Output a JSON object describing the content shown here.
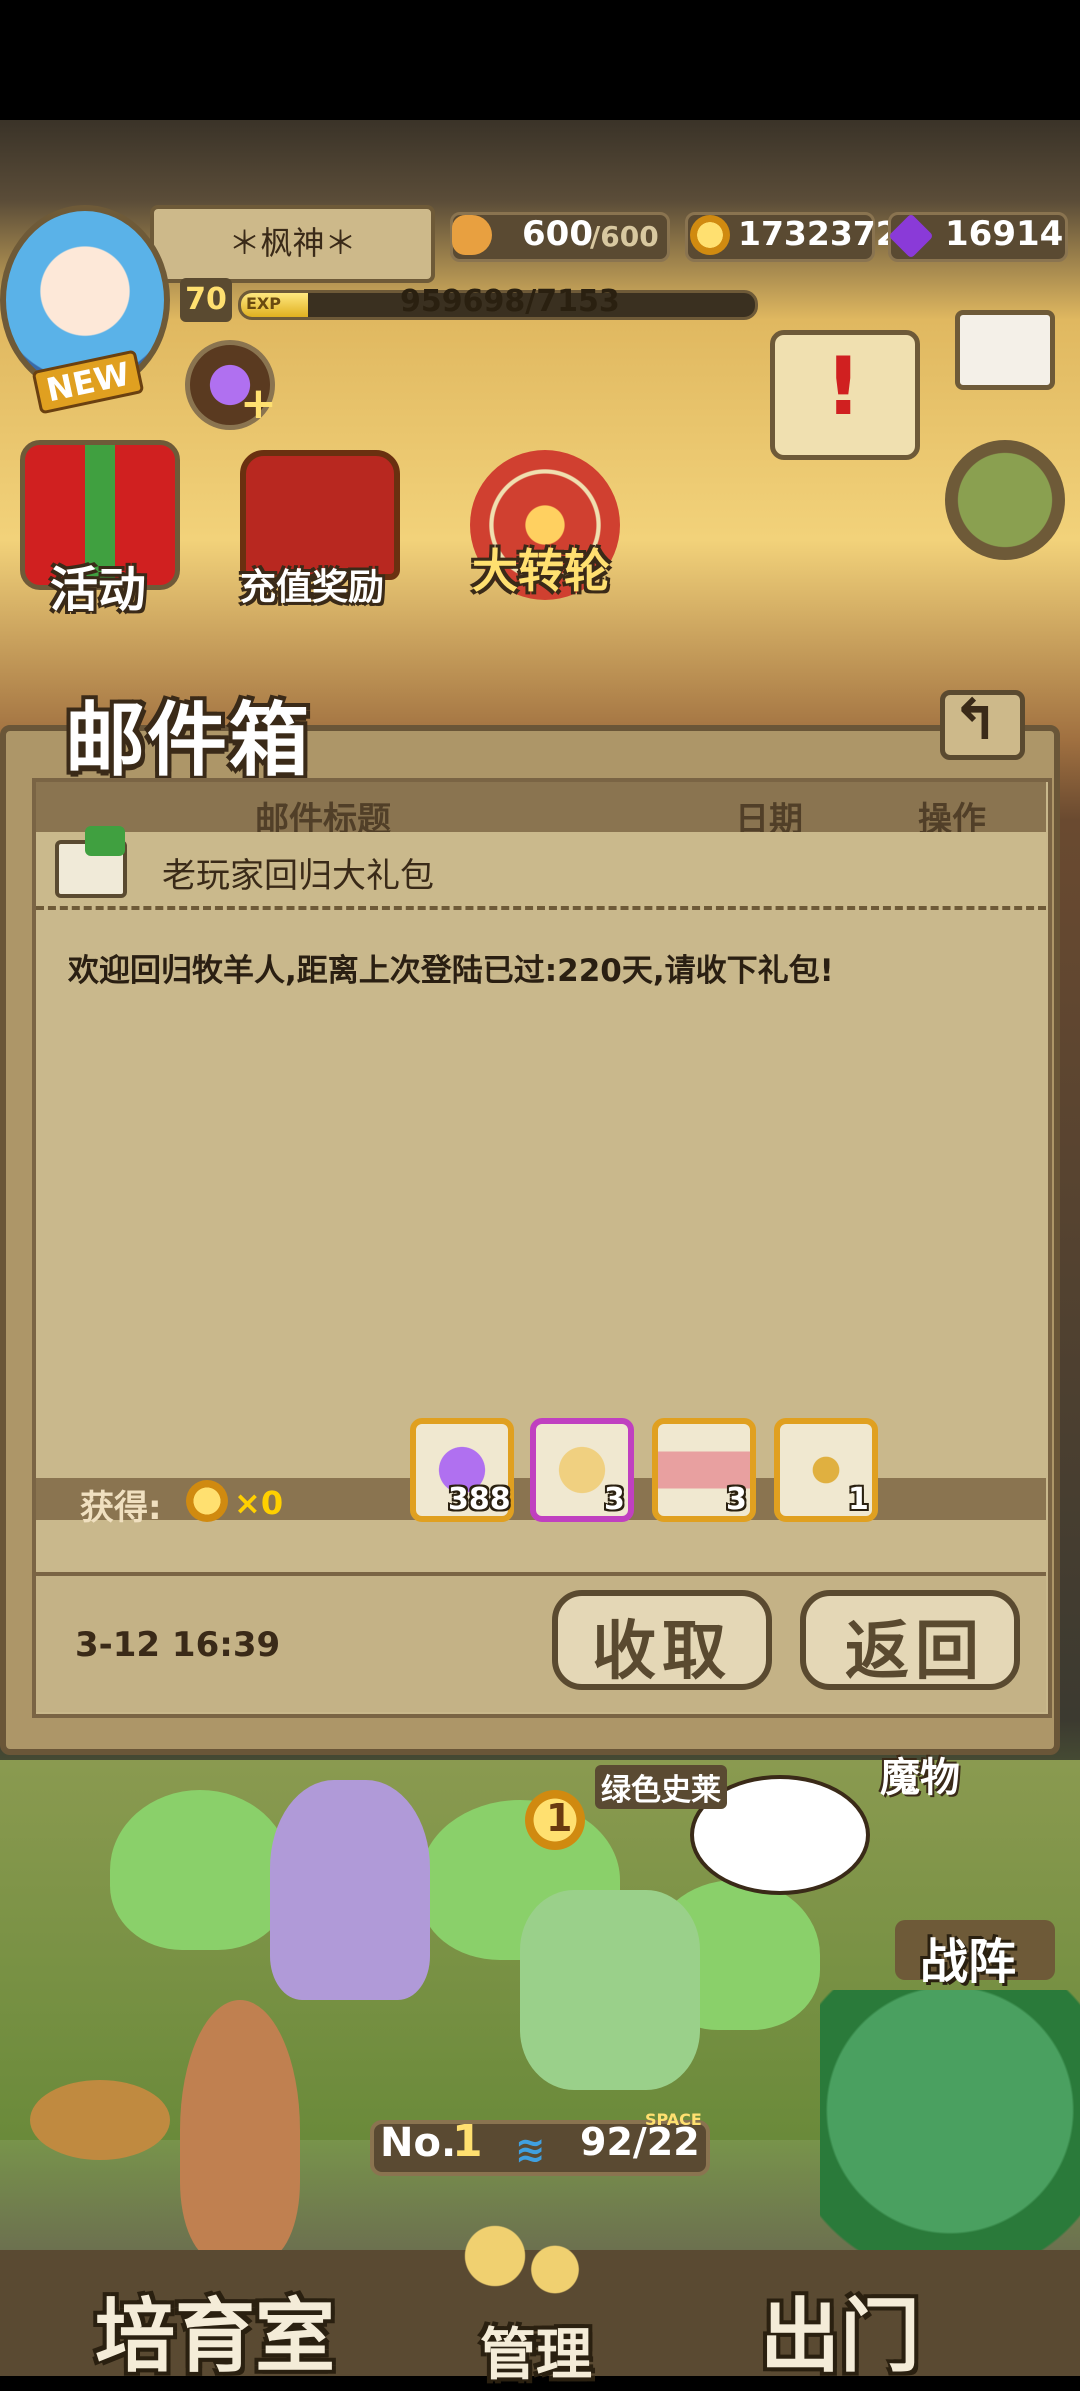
{
  "hud": {
    "player_name": "＊枫神＊",
    "new_badge": "NEW",
    "level": "70",
    "exp_tag": "EXP",
    "exp_text": "959698/7153C",
    "exp_fraction": 0.13,
    "stamina_value": "600",
    "stamina_max": "/600",
    "gold": "1732372",
    "gems": "16914"
  },
  "menu": {
    "events": "活动",
    "recharge": "充值奖励",
    "wheel": "大转轮"
  },
  "mailbox": {
    "title": "邮件箱",
    "columns": {
      "title": "邮件标题",
      "date": "日期",
      "action": "操作"
    },
    "subject": "老玩家回归大礼包",
    "body": "欢迎回归牧羊人,距离上次登陆已过:220天,请收下礼包!",
    "gain_label": "获得:",
    "gain_count": "×0",
    "items": [
      {
        "icon": "purple-gem-icon",
        "count": "388"
      },
      {
        "icon": "helmet-icon",
        "count": "3"
      },
      {
        "icon": "ticket-icon",
        "count": "3"
      },
      {
        "icon": "golden-key-icon",
        "count": "1"
      }
    ],
    "time": "3-12 16:39",
    "collect_label": "收取",
    "return_label": "返回"
  },
  "world": {
    "monster_label": "绿色史莱",
    "level_coin": "1",
    "corner_label": "魔物",
    "formation_label": "战阵",
    "rank_label": "No.",
    "rank_value": "1",
    "space_value": "92/22",
    "space_tag": "SPACE",
    "nursery_label": "培育室",
    "manage_label": "管理",
    "exit_label": "出门"
  },
  "colors": {
    "panel": "#ad9668",
    "panel_border": "#6a5638",
    "gold_text": "#ffd000",
    "accent_purple": "#8a3ad8"
  }
}
